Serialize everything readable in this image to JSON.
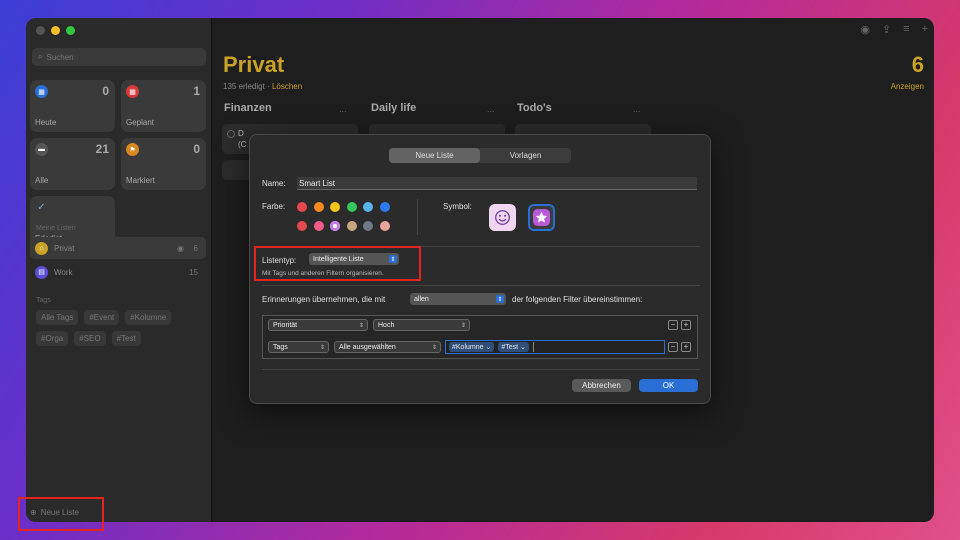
{
  "sidebar": {
    "search_placeholder": "Suchen",
    "smart_lists": [
      {
        "label": "Heute",
        "count": "0",
        "icon": "calendar-today-icon",
        "color": "#2a6fd6"
      },
      {
        "label": "Geplant",
        "count": "1",
        "icon": "calendar-icon",
        "color": "#d63a3a"
      },
      {
        "label": "Alle",
        "count": "21",
        "icon": "tray-icon",
        "color": "#555555"
      },
      {
        "label": "Markiert",
        "count": "0",
        "icon": "flag-icon",
        "color": "#d6881f"
      },
      {
        "label": "Erledigt",
        "count": "",
        "icon": "checkmark-icon",
        "color": "#555555"
      }
    ],
    "my_lists_header": "Meine Listen",
    "lists": [
      {
        "label": "Privat",
        "count": "6",
        "icon": "house-icon",
        "color": "#c9a227"
      },
      {
        "label": "Work",
        "count": "15",
        "icon": "briefcase-icon",
        "color": "#5a4fd6"
      }
    ],
    "tags_header": "Tags",
    "tags": [
      "Alle Tags",
      "#Event",
      "#Kolumne",
      "#Orga",
      "#SEO",
      "#Test"
    ],
    "new_list": "Neue Liste"
  },
  "main": {
    "title": "Privat",
    "count": "6",
    "completed": "135 erledigt",
    "separator": "·",
    "delete_link": "Löschen",
    "show_link": "Anzeigen",
    "columns": [
      "Finanzen",
      "Daily life",
      "Todo's"
    ],
    "column_more": "...",
    "card_fragments": [
      "D",
      "(C"
    ]
  },
  "dialog": {
    "tabs": [
      "Neue Liste",
      "Vorlagen"
    ],
    "name_label": "Name:",
    "name_value": "Smart List",
    "color_label": "Farbe:",
    "colors": [
      "#e5484d",
      "#f58a1f",
      "#f5c518",
      "#35c759",
      "#5ab3f0",
      "#2a7cf0",
      "#e5484d",
      "#f25c8c",
      "#c67be8",
      "#c9a77c",
      "#6e7a87",
      "#e9a59b"
    ],
    "symbol_label": "Symbol:",
    "symbols": [
      "smiley-icon",
      "star-icon"
    ],
    "list_type_label": "Listentyp:",
    "list_type_value": "Intelligente Liste",
    "list_type_hint": "Mit Tags und anderen Filtern organisieren.",
    "match_prefix": "Erinnerungen übernehmen, die mit",
    "match_value": "allen",
    "match_suffix": "der folgenden Filter übereinstimmen:",
    "filters": [
      {
        "field": "Priorität",
        "operator": "Hoch"
      },
      {
        "field": "Tags",
        "operator": "Alle ausgewählten",
        "tokens": [
          "#Kolumne",
          "#Test"
        ]
      }
    ],
    "cancel": "Abbrechen",
    "ok": "OK",
    "accent": "#2a6fd6"
  }
}
